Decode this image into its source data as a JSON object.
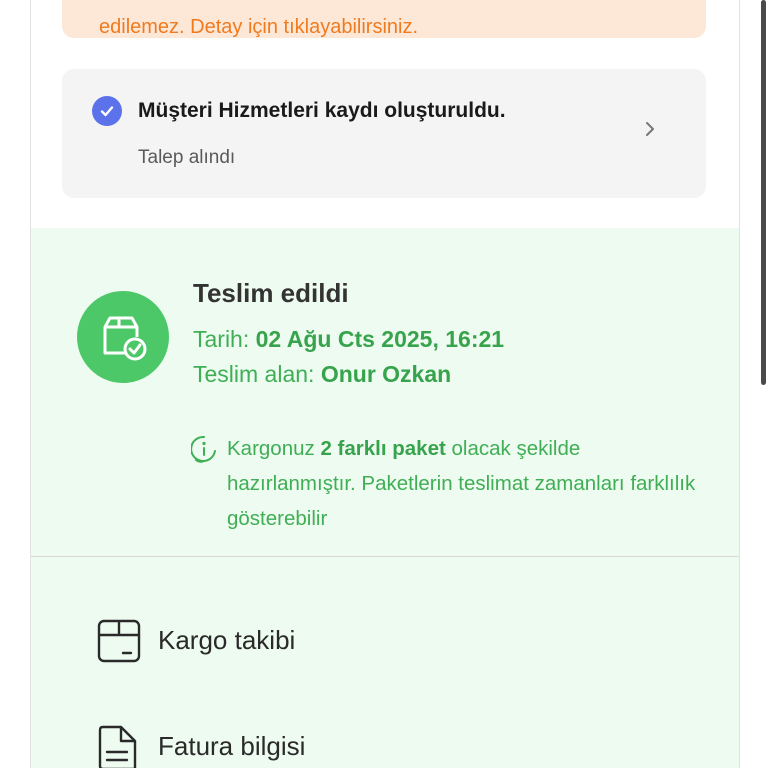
{
  "banner": {
    "text": "edilemez. Detay için tıklayabilirsiniz."
  },
  "ticket": {
    "title": "Müşteri Hizmetleri kaydı oluşturuldu.",
    "subtitle": "Talep alındı"
  },
  "delivery": {
    "status": "Teslim edildi",
    "date_label": "Tarih:",
    "date_value": "02 Ağu Cts 2025, 16:21",
    "receiver_label": "Teslim alan:",
    "receiver_value": "Onur Ozkan",
    "info": {
      "prefix": "Kargonuz ",
      "highlight": "2 farklı paket",
      "suffix": " olacak şekilde hazırlanmıştır. Paketlerin teslimat zamanları farklılık gösterebilir"
    }
  },
  "actions": [
    {
      "label": "Kargo takibi",
      "icon": "box-icon"
    },
    {
      "label": "Fatura bilgisi",
      "icon": "document-icon"
    }
  ],
  "colors": {
    "accent_green": "#4dc868",
    "text_green": "#3fae55",
    "banner_orange": "#f07a1e",
    "check_blue": "#5b72ea"
  }
}
